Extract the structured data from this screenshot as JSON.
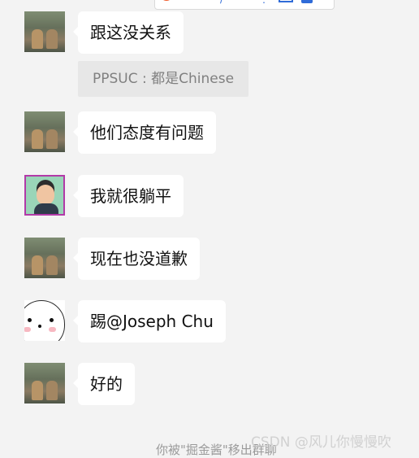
{
  "messages": [
    {
      "text": "跟这没关系",
      "avatar": "photo"
    },
    {
      "text": "他们态度有问题",
      "avatar": "photo"
    },
    {
      "text": "我就很躺平",
      "avatar": "cartoon"
    },
    {
      "text": "现在也没道歉",
      "avatar": "photo"
    },
    {
      "text": "踢@Joseph Chu",
      "avatar": "ghost"
    },
    {
      "text": "好的",
      "avatar": "photo"
    }
  ],
  "quote": {
    "text": "PPSUC : 都是Chinese"
  },
  "footer": {
    "system_message": "你被\"掘金酱\"移出群聊",
    "watermark": "CSDN @风儿你慢慢吹"
  },
  "colors": {
    "background": "#f3f3f3",
    "bubble": "#ffffff",
    "quote_background": "#e7e7e7",
    "accent": "#2f6bd8",
    "brand": "#f05a28"
  },
  "icons": [
    "app-logo-icon",
    "toolbar-icon-a",
    "toolbar-icon-b",
    "toolbar-icon-c",
    "toolbar-icon-d",
    "toolbar-icon-e"
  ]
}
